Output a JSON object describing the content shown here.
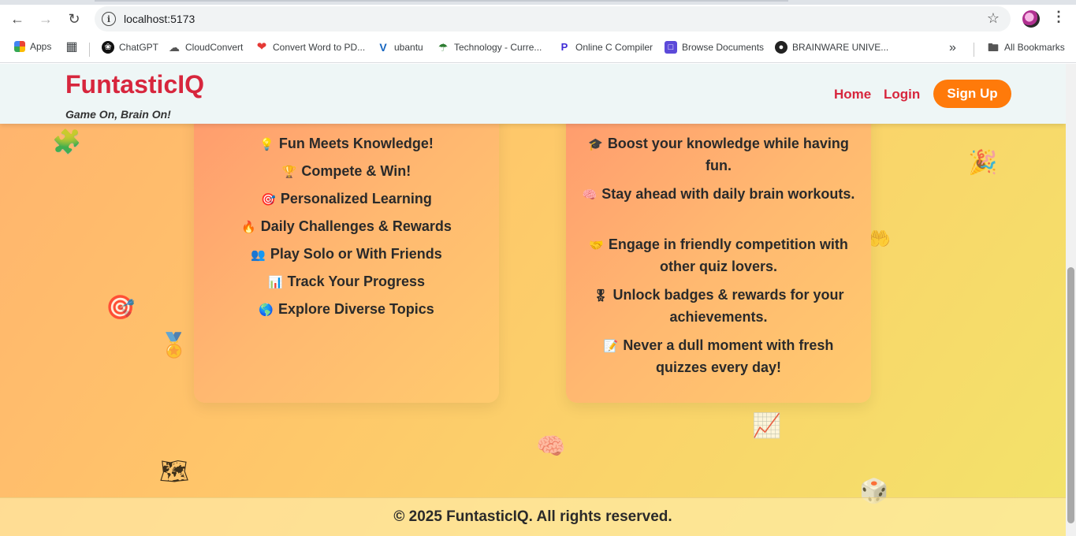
{
  "browser": {
    "url": "localhost:5173",
    "bookmarks": [
      {
        "label": "Apps",
        "icon": "apps-grid-icon"
      },
      {
        "label": "",
        "icon": "grid-icon"
      },
      {
        "label": "ChatGPT",
        "icon": "chatgpt-icon"
      },
      {
        "label": "CloudConvert",
        "icon": "cloud-icon"
      },
      {
        "label": "Convert Word to PD...",
        "icon": "heart-icon"
      },
      {
        "label": "ubantu",
        "icon": "v-logo-icon"
      },
      {
        "label": "Technology - Curre...",
        "icon": "umbrella-icon"
      },
      {
        "label": "Online C Compiler",
        "icon": "p-logo-icon"
      },
      {
        "label": "Browse Documents",
        "icon": "document-icon"
      },
      {
        "label": "BRAINWARE UNIVE...",
        "icon": "globe-icon"
      },
      {
        "label": "All Bookmarks",
        "icon": "folder-icon"
      }
    ]
  },
  "header": {
    "brand": "FuntasticIQ",
    "tagline": "Game On, Brain On!",
    "nav": {
      "home": "Home",
      "login": "Login",
      "signup": "Sign Up"
    }
  },
  "features": [
    {
      "icon": "💡",
      "text": "Fun Meets Knowledge!"
    },
    {
      "icon": "🏆",
      "text": "Compete & Win!"
    },
    {
      "icon": "🎯",
      "text": "Personalized Learning"
    },
    {
      "icon": "🔥",
      "text": "Daily Challenges & Rewards"
    },
    {
      "icon": "👥",
      "text": "Play Solo or With Friends"
    },
    {
      "icon": "📊",
      "text": "Track Your Progress"
    },
    {
      "icon": "🌎",
      "text": "Explore Diverse Topics"
    }
  ],
  "benefits": [
    {
      "icon": "🎓",
      "text": "Boost your knowledge while having fun."
    },
    {
      "icon": "🧠",
      "text": "Stay ahead with daily brain workouts."
    },
    {
      "icon": "🤝",
      "text": "Engage in friendly competition with other quiz lovers."
    },
    {
      "icon": "🎖",
      "text": "Unlock badges & rewards for your achievements."
    },
    {
      "icon": "📝",
      "text": "Never a dull moment with fresh quizzes every day!"
    }
  ],
  "footer": {
    "text": "© 2025 FuntasticIQ. All rights reserved."
  },
  "colors": {
    "brand": "#d7263d",
    "signup": "#ff7a0a"
  }
}
